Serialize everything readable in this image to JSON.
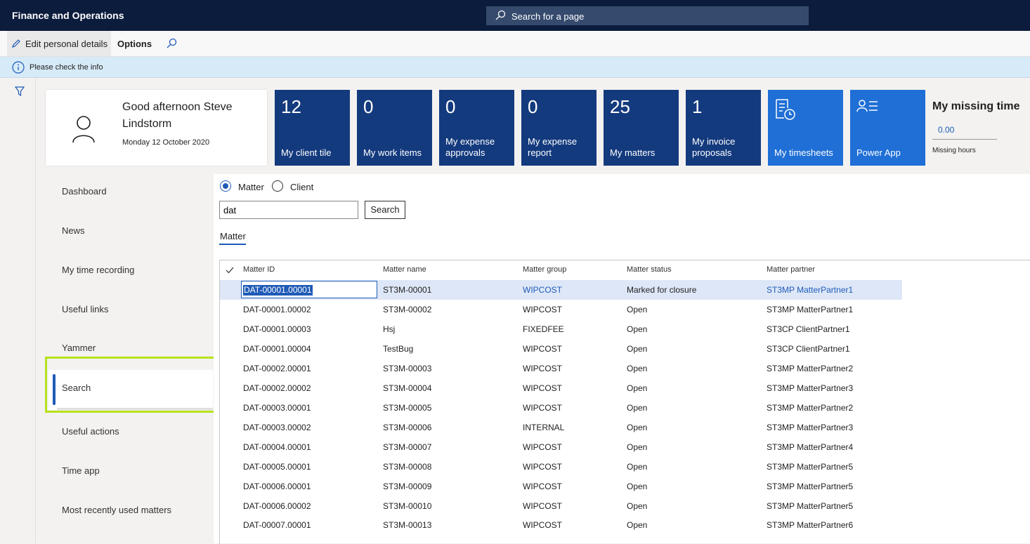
{
  "topbar": {
    "title": "Finance and Operations",
    "search_placeholder": "Search for a page"
  },
  "actionbar": {
    "edit": "Edit personal details",
    "options": "Options"
  },
  "info": {
    "message": "Please check the info"
  },
  "greeting": {
    "hello": "Good afternoon Steve Lindstorm",
    "date": "Monday 12 October 2020"
  },
  "tiles": [
    {
      "num": "12",
      "label": "My client tile"
    },
    {
      "num": "0",
      "label": "My work items"
    },
    {
      "num": "0",
      "label": "My expense approvals"
    },
    {
      "num": "0",
      "label": "My expense report"
    },
    {
      "num": "25",
      "label": "My matters"
    },
    {
      "num": "1",
      "label": "My invoice proposals"
    },
    {
      "num": "",
      "label": "My timesheets",
      "icon": "timesheet-icon"
    },
    {
      "num": "",
      "label": "Power App",
      "icon": "contact-list-icon"
    }
  ],
  "missing": {
    "title": "My missing time",
    "value": "0.00",
    "label": "Missing hours"
  },
  "nav": [
    "Dashboard",
    "News",
    "My time recording",
    "Useful links",
    "Yammer",
    "Search",
    "Useful actions",
    "Time app",
    "Most recently used matters"
  ],
  "search": {
    "option_matter": "Matter",
    "option_client": "Client",
    "value": "dat",
    "button": "Search",
    "tab": "Matter"
  },
  "grid": {
    "headers": [
      "Matter ID",
      "Matter name",
      "Matter group",
      "Matter status",
      "Matter partner"
    ],
    "rows": [
      [
        "DAT-00001.00001",
        "ST3M-00001",
        "WIPCOST",
        "Marked for closure",
        "ST3MP MatterPartner1"
      ],
      [
        "DAT-00001.00002",
        "ST3M-00002",
        "WIPCOST",
        "Open",
        "ST3MP MatterPartner1"
      ],
      [
        "DAT-00001.00003",
        "Hsj",
        "FIXEDFEE",
        "Open",
        "ST3CP ClientPartner1"
      ],
      [
        "DAT-00001.00004",
        "TestBug",
        "WIPCOST",
        "Open",
        "ST3CP ClientPartner1"
      ],
      [
        "DAT-00002.00001",
        "ST3M-00003",
        "WIPCOST",
        "Open",
        "ST3MP MatterPartner2"
      ],
      [
        "DAT-00002.00002",
        "ST3M-00004",
        "WIPCOST",
        "Open",
        "ST3MP MatterPartner3"
      ],
      [
        "DAT-00003.00001",
        "ST3M-00005",
        "WIPCOST",
        "Open",
        "ST3MP MatterPartner2"
      ],
      [
        "DAT-00003.00002",
        "ST3M-00006",
        "INTERNAL",
        "Open",
        "ST3MP MatterPartner3"
      ],
      [
        "DAT-00004.00001",
        "ST3M-00007",
        "WIPCOST",
        "Open",
        "ST3MP MatterPartner4"
      ],
      [
        "DAT-00005.00001",
        "ST3M-00008",
        "WIPCOST",
        "Open",
        "ST3MP MatterPartner5"
      ],
      [
        "DAT-00006.00001",
        "ST3M-00009",
        "WIPCOST",
        "Open",
        "ST3MP MatterPartner5"
      ],
      [
        "DAT-00006.00002",
        "ST3M-00010",
        "WIPCOST",
        "Open",
        "ST3MP MatterPartner5"
      ],
      [
        "DAT-00007.00001",
        "ST3M-00013",
        "WIPCOST",
        "Open",
        "ST3MP MatterPartner6"
      ]
    ]
  },
  "colors": {
    "header": "#0b1c3c",
    "tile_dark": "#143a7e",
    "tile_bright": "#1f6fd6",
    "accent": "#1f5bb7",
    "highlight": "#b7e21b"
  }
}
